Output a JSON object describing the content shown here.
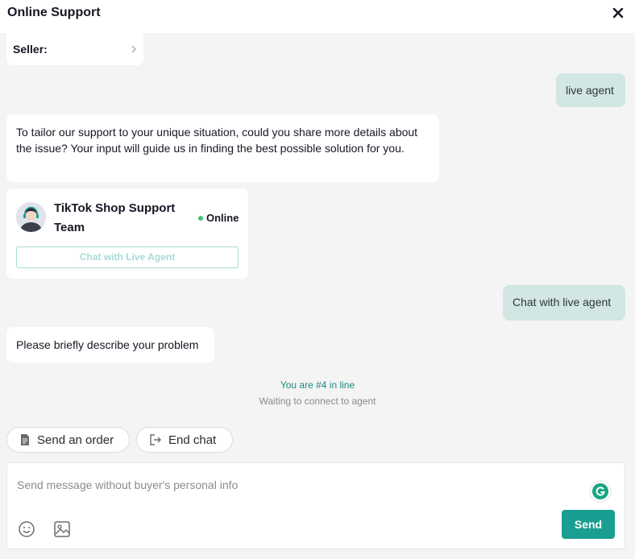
{
  "header": {
    "title": "Online Support",
    "close_icon": "close-icon"
  },
  "seller": {
    "label": "Seller:",
    "chevron_icon": "chevron-right-icon"
  },
  "messages": {
    "user_1": "live agent",
    "bot_1": "To tailor our support to your unique situation, could you share more details about the issue? Your input will guide us in finding the best possible solution for you.",
    "user_2": "Chat with live agent",
    "bot_2": "Please briefly describe your problem"
  },
  "agent_card": {
    "name": "TikTok Shop Support Team",
    "status": "Online",
    "button_label": "Chat with Live Agent",
    "status_color": "#3cc47c"
  },
  "queue": {
    "position_text": "You are #4 in line",
    "waiting_text": "Waiting to connect to agent"
  },
  "quick_actions": [
    {
      "label": "Send an order",
      "icon": "document-icon"
    },
    {
      "label": "End chat",
      "icon": "exit-icon"
    }
  ],
  "composer": {
    "placeholder": "Send message without buyer's personal info",
    "value": "",
    "send_label": "Send",
    "icons": [
      "grammarly-icon",
      "emoji-icon",
      "image-icon"
    ]
  },
  "colors": {
    "accent": "#1b9e92",
    "user_bubble": "#d2e6e3",
    "queue_text": "#1b8a80"
  }
}
